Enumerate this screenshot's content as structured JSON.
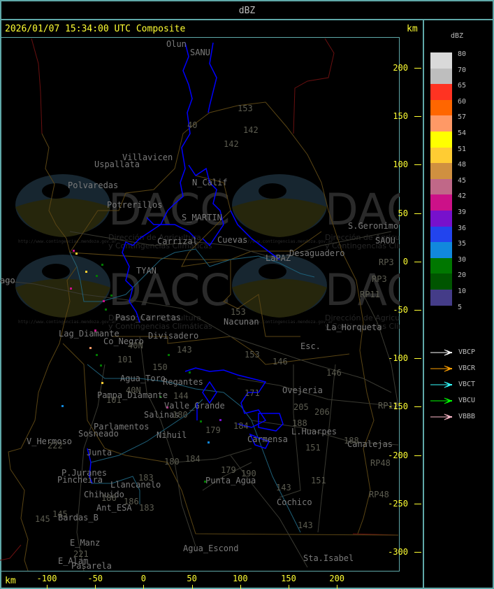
{
  "window_title": "dBZ",
  "header": {
    "timestamp": "2026/01/07 15:34:00 UTC Composite",
    "unit_top": "km",
    "unit_bottom": "km"
  },
  "axes": {
    "x_ticks": [
      "-100",
      "-50",
      "0",
      "50",
      "100",
      "150",
      "200"
    ],
    "y_ticks": [
      "200",
      "150",
      "100",
      "50",
      "0",
      "-50",
      "-100",
      "-150",
      "-200",
      "-250",
      "-300"
    ]
  },
  "legend": {
    "title": "dBZ",
    "bins": [
      {
        "label": "80",
        "color": "#d9d9d9"
      },
      {
        "label": "70",
        "color": "#bebebe"
      },
      {
        "label": "65",
        "color": "#ff3322"
      },
      {
        "label": "60",
        "color": "#ff6600"
      },
      {
        "label": "57",
        "color": "#ff9966"
      },
      {
        "label": "54",
        "color": "#ffff00"
      },
      {
        "label": "51",
        "color": "#ffcc33"
      },
      {
        "label": "48",
        "color": "#d09040"
      },
      {
        "label": "45",
        "color": "#c06888"
      },
      {
        "label": "42",
        "color": "#cc1188"
      },
      {
        "label": "39",
        "color": "#7711cc"
      },
      {
        "label": "36",
        "color": "#2244ee"
      },
      {
        "label": "35",
        "color": "#1188dd"
      },
      {
        "label": "30",
        "color": "#007700"
      },
      {
        "label": "20",
        "color": "#005500"
      },
      {
        "label": "10",
        "color": "#443c88"
      }
    ],
    "last_label": "5",
    "radars": [
      {
        "name": "VBCP",
        "color": "#ffffff"
      },
      {
        "name": "VBCR",
        "color": "#ffa000"
      },
      {
        "name": "VBCT",
        "color": "#33ffff"
      },
      {
        "name": "VBCU",
        "color": "#00ff00"
      },
      {
        "name": "VBBB",
        "color": "#ffbbcc"
      }
    ]
  },
  "watermark": {
    "brand": "DACC",
    "line1": "Dirección de Agricultura",
    "line2": "y Contingencias Climáticas",
    "url": "http://www.contingencias.mendoza.gov.ar"
  },
  "places": [
    "Villavicen",
    "Uspallata",
    "Polvaredas",
    "Potrerillos",
    "N_Calif",
    "S_MARTIN",
    "Carrizal",
    "Cuevas",
    "LaPAZ",
    "Desaguadero",
    "S.Geronimo",
    "SAOU",
    "Nacunan",
    "La_Horqueta",
    "Esc.",
    "Paso_Carretas",
    "Divisadero",
    "Lag_Diamante",
    "Co_Negro",
    "Agua_Toro",
    "Pampa_Diamante",
    "Valle_Grande",
    "Salinas",
    "Parlamentos",
    "Sosneado",
    "Nihuil",
    "V_Hermoso",
    "Junta",
    "P.Juranes",
    "Pincheira",
    "Llancanelo",
    "Chihuido",
    "Ant_ESA",
    "Bardas_B",
    "E_Manz",
    "E_Alam",
    "Pasarela",
    "Punta_Agua",
    "Agua_Escond",
    "Ovejeria",
    "L.Huarpes",
    "Carmensa",
    "Canalejas",
    "Cochico",
    "Sta.Isabel",
    "Olun",
    "SANU",
    "ago",
    "TYAN",
    "Regantes"
  ],
  "routes": [
    "40",
    "142",
    "142",
    "153",
    "153",
    "146",
    "146",
    "143",
    "150",
    "101",
    "101",
    "40N",
    "40N",
    "144",
    "180",
    "180",
    "184",
    "184",
    "179",
    "179",
    "183",
    "183",
    "186",
    "186",
    "145",
    "145",
    "221",
    "222",
    "190",
    "205",
    "206",
    "188",
    "188",
    "151",
    "151",
    "143",
    "143",
    "RP3",
    "RP3",
    "RP11",
    "RP12",
    "RP48",
    "RP48",
    "153",
    "171"
  ],
  "colors": {
    "frame": "#5fa8a8",
    "axis": "#ffff33",
    "echo": "#0000ff",
    "border": "#5a4514",
    "intl_border": "#6a1010",
    "river": "#1e5f78",
    "road": "#3a3a32"
  }
}
